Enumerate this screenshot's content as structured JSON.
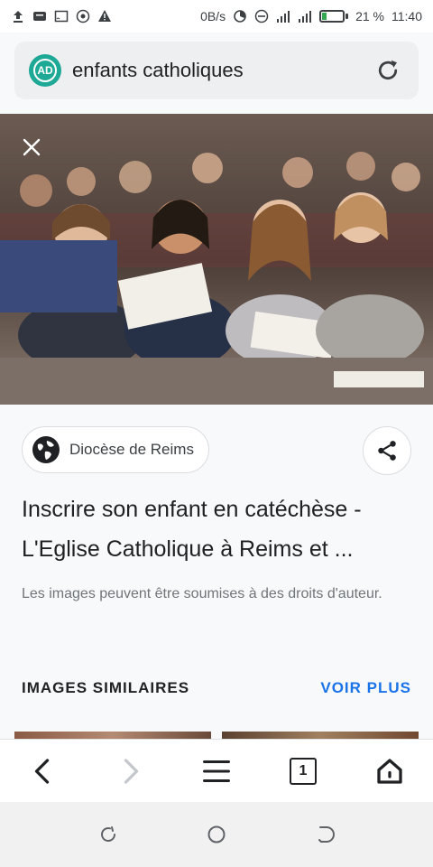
{
  "status_bar": {
    "net_speed": "0B/s",
    "battery_percent": "21 %",
    "time": "11:40",
    "battery_color": "#34a853"
  },
  "search": {
    "query": "enfants catholiques",
    "badge": "AD",
    "badge_color": "#1ea896",
    "reload_icon": "reload-icon"
  },
  "result": {
    "close_icon": "close-icon",
    "source_label": "Diocèse de Reims",
    "title": "Inscrire son enfant en catéchèse - L'Eglise Catholique à Reims et ...",
    "notice": "Les images peuvent être soumises à des droits d'auteur.",
    "share_icon": "share-icon"
  },
  "similar": {
    "heading": "IMAGES SIMILAIRES",
    "see_more": "VOIR PLUS",
    "accent": "#1a73e8"
  },
  "toolbar": {
    "tabs_count": "1",
    "items": [
      "back-icon",
      "forward-icon",
      "menu-icon",
      "tabs-button",
      "home-icon"
    ]
  },
  "system_nav": {
    "items": [
      "recents-icon",
      "home-circle-icon",
      "back-sys-icon"
    ]
  }
}
